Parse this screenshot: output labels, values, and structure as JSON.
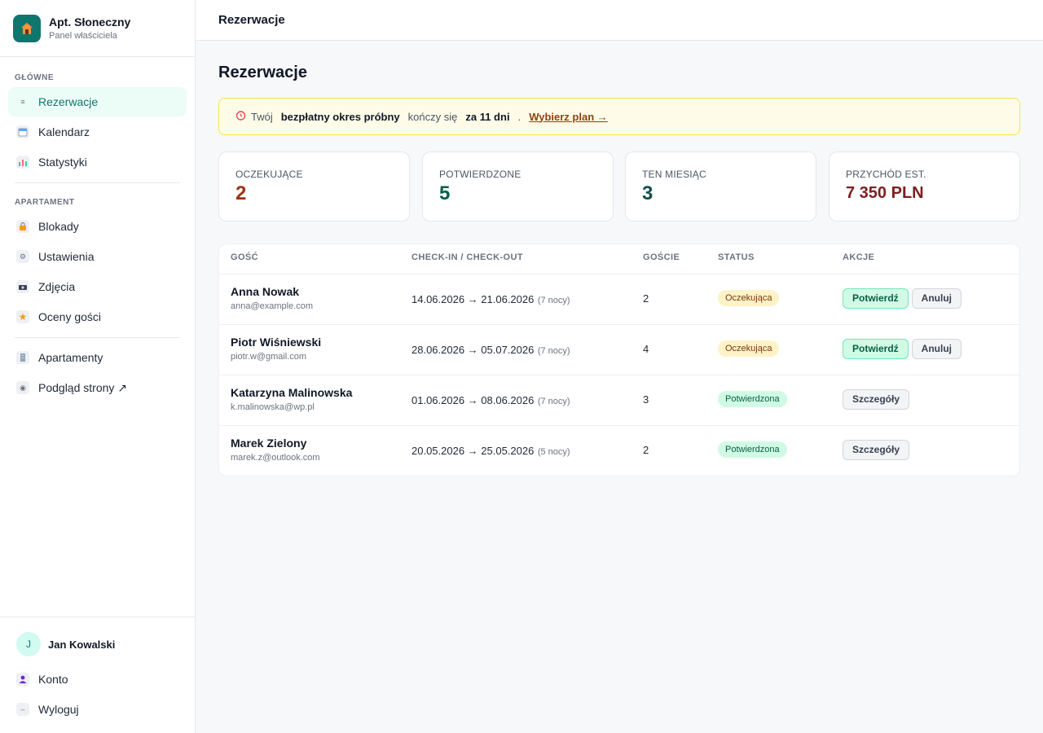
{
  "brand": {
    "name": "Apt. Słoneczny",
    "subtitle": "Panel właściciela"
  },
  "sidebar": {
    "section_main": "GŁÓWNE",
    "section_apartment": "APARTAMENT",
    "items": [
      {
        "label": "Rezerwacje",
        "icon": "list-icon"
      },
      {
        "label": "Kalendarz",
        "icon": "calendar-icon"
      },
      {
        "label": "Statystyki",
        "icon": "chart-icon"
      },
      {
        "label": "Blokady",
        "icon": "lock-icon"
      },
      {
        "label": "Ustawienia",
        "icon": "gear-icon"
      },
      {
        "label": "Zdjęcia",
        "icon": "camera-icon"
      },
      {
        "label": "Oceny gości",
        "icon": "star-icon"
      },
      {
        "label": "Apartamenty",
        "icon": "building-icon"
      },
      {
        "label": "Podgląd strony ↗",
        "icon": "eye-icon"
      }
    ],
    "user": {
      "initial": "J",
      "name": "Jan Kowalski"
    },
    "account": {
      "label": "Konto",
      "icon": "user-icon"
    },
    "logout": {
      "label": "Wyloguj",
      "icon": "logout-icon"
    }
  },
  "topbar": {
    "title": "Rezerwacje"
  },
  "page": {
    "title": "Rezerwacje"
  },
  "trial": {
    "part1": "Twój",
    "bold1": "bezpłatny okres próbny",
    "part2": "kończy się",
    "bold2": "za 11 dni",
    "dot": ".",
    "link": "Wybierz plan →"
  },
  "stats": [
    {
      "label": "OCZEKUJĄCE",
      "value": "2",
      "color": "#9a3412"
    },
    {
      "label": "POTWIERDZONE",
      "value": "5",
      "color": "#065f46"
    },
    {
      "label": "TEN MIESIĄC",
      "value": "3",
      "color": "#134e4a"
    },
    {
      "label": "PRZYCHÓD EST.",
      "value": "7 350 PLN",
      "color": "#7f1d1d"
    }
  ],
  "table": {
    "headers": [
      "GOŚĆ",
      "CHECK-IN / CHECK-OUT",
      "GOŚCIE",
      "STATUS",
      "AKCJE"
    ],
    "rows": [
      {
        "name": "Anna Nowak",
        "email": "anna@example.com",
        "dates": "14.06.2026 → 21.06.2026",
        "nights": "(7 nocy)",
        "guests": "2",
        "status": "Oczekująca",
        "status_type": "pending",
        "actions": [
          "Potwierdź",
          "Anuluj"
        ]
      },
      {
        "name": "Piotr Wiśniewski",
        "email": "piotr.w@gmail.com",
        "dates": "28.06.2026 → 05.07.2026",
        "nights": "(7 nocy)",
        "guests": "4",
        "status": "Oczekująca",
        "status_type": "pending",
        "actions": [
          "Potwierdź",
          "Anuluj"
        ]
      },
      {
        "name": "Katarzyna Malinowska",
        "email": "k.malinowska@wp.pl",
        "dates": "01.06.2026 → 08.06.2026",
        "nights": "(7 nocy)",
        "guests": "3",
        "status": "Potwierdzona",
        "status_type": "confirmed",
        "actions": [
          "Szczegóły"
        ]
      },
      {
        "name": "Marek Zielony",
        "email": "marek.z@outlook.com",
        "dates": "20.05.2026 → 25.05.2026",
        "nights": "(5 nocy)",
        "guests": "2",
        "status": "Potwierdzona",
        "status_type": "confirmed",
        "actions": [
          "Szczegóły"
        ]
      }
    ]
  }
}
